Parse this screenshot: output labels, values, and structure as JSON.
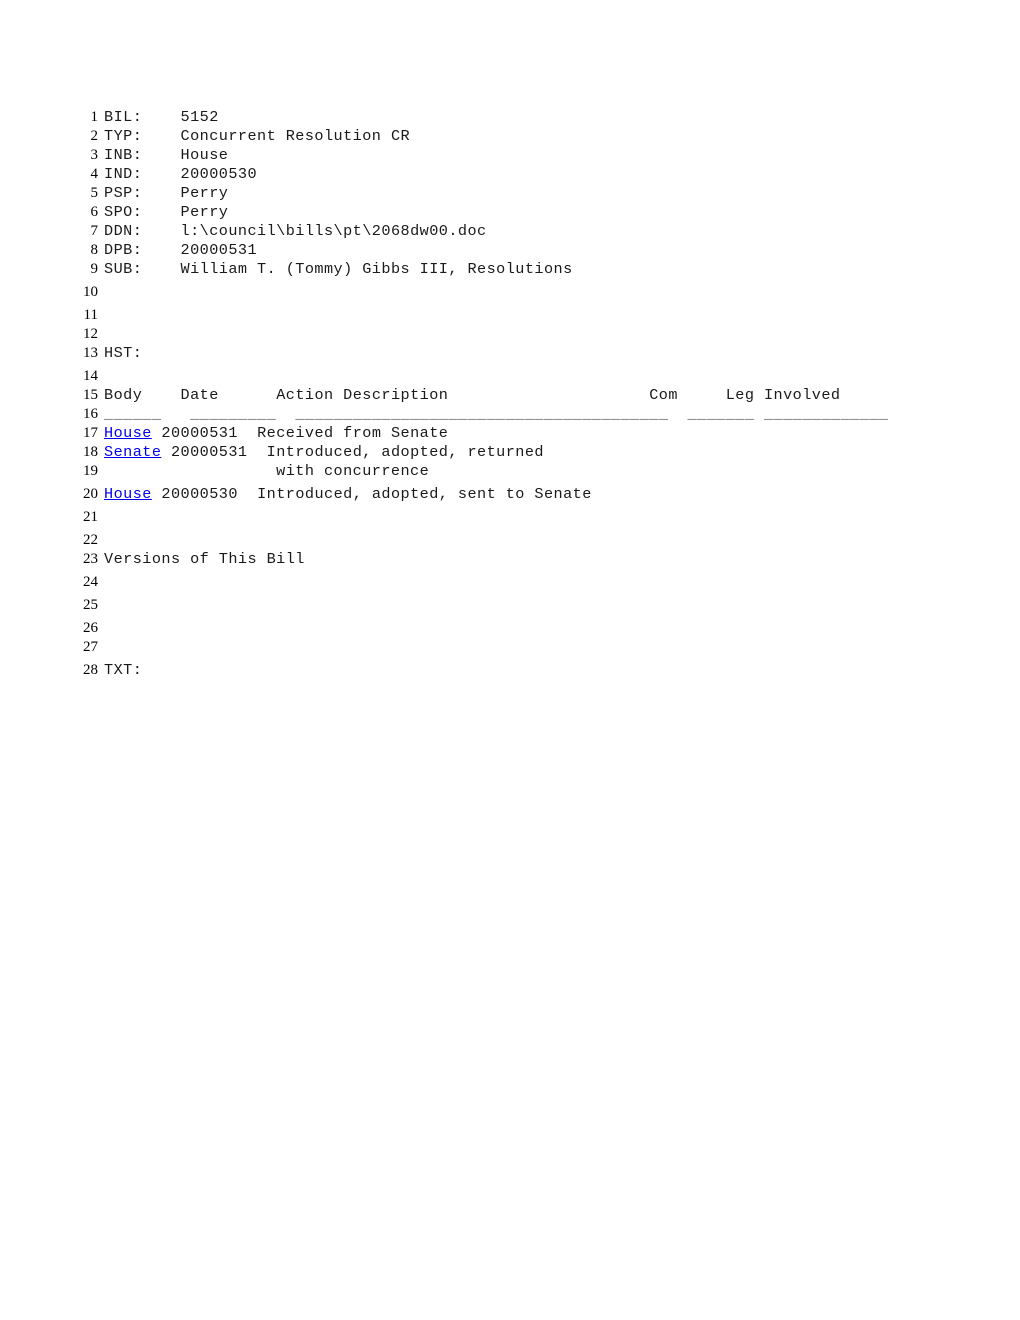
{
  "document": {
    "kind": "legislative-bill-record",
    "fields": [
      {
        "line": 1,
        "label": "BIL:",
        "value": "5152"
      },
      {
        "line": 2,
        "label": "TYP:",
        "value": "Concurrent Resolution CR"
      },
      {
        "line": 3,
        "label": "INB:",
        "value": "House"
      },
      {
        "line": 4,
        "label": "IND:",
        "value": "20000530"
      },
      {
        "line": 5,
        "label": "PSP:",
        "value": "Perry"
      },
      {
        "line": 6,
        "label": "SPO:",
        "value": "Perry"
      },
      {
        "line": 7,
        "label": "DDN:",
        "value": "l:\\council\\bills\\pt\\2068dw00.doc"
      },
      {
        "line": 8,
        "label": "DPB:",
        "value": "20000531"
      },
      {
        "line": 9,
        "label": "SUB:",
        "value": "William T. (Tommy) Gibbs III, Resolutions"
      }
    ],
    "history_label": "HST:",
    "history_line": 13,
    "history_table": {
      "header_line": 15,
      "rule_line": 16,
      "columns": [
        "Body",
        "Date",
        "Action Description",
        "Com",
        "Leg Involved"
      ],
      "rules": [
        "______",
        "_________",
        "_______________________________________",
        "_______",
        "_____________"
      ],
      "rows": [
        {
          "line": 17,
          "body": "House",
          "body_is_link": true,
          "date": "20000531",
          "action": "Received from Senate",
          "com": "",
          "leg_involved": ""
        },
        {
          "line": 18,
          "body": "Senate",
          "body_is_link": true,
          "date": "20000531",
          "action": "Introduced, adopted, returned",
          "com": "",
          "leg_involved": ""
        },
        {
          "line": 19,
          "body": "",
          "body_is_link": false,
          "date": "",
          "action": "with concurrence",
          "com": "",
          "leg_involved": ""
        },
        {
          "line": 20,
          "body": "House",
          "body_is_link": true,
          "date": "20000530",
          "action": "Introduced, adopted, sent to Senate",
          "com": "",
          "leg_involved": ""
        }
      ]
    },
    "versions_label": "Versions of This Bill",
    "versions_line": 23,
    "text_label": "TXT:",
    "text_line": 28,
    "blank_lines": [
      10,
      11,
      12,
      14,
      21,
      22,
      24,
      25,
      26,
      27
    ]
  },
  "colors": {
    "page_background": "#ffffff",
    "body_text": "#1a1a1a",
    "line_number": "#000000",
    "link": "#0000ee",
    "rule": "#555555"
  }
}
